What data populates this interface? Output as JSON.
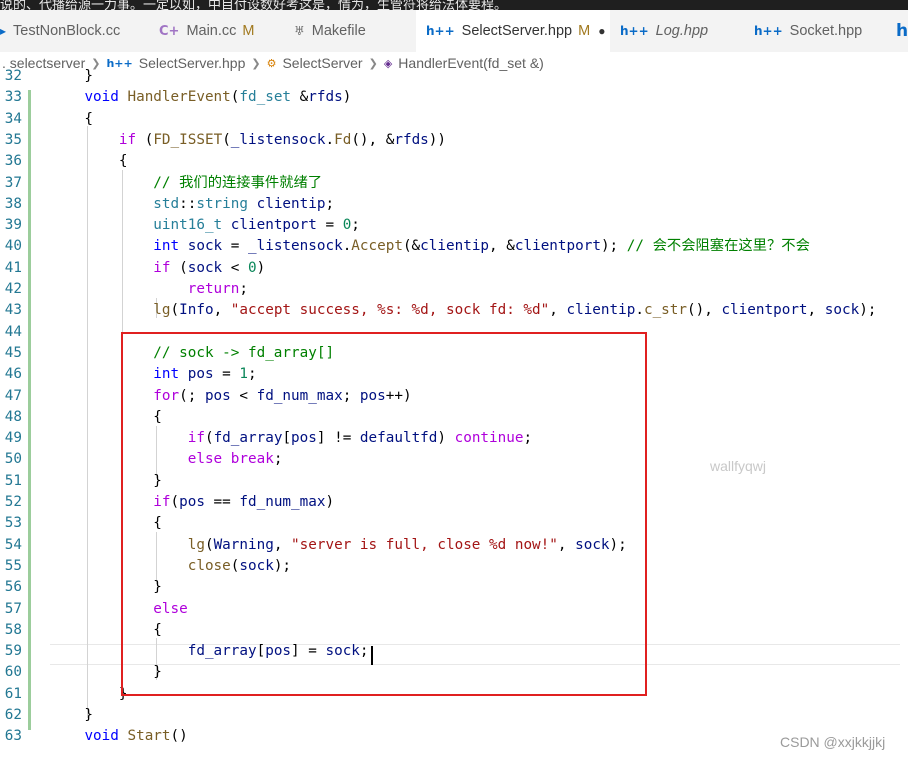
{
  "banner": {
    "text": "说的、代播给源一力事。一定以如，中目付设数好考这是，情为，生管符将给法体要程。"
  },
  "tabs": [
    {
      "icon": "arrow-icon",
      "label": "TestNonBlock.cc",
      "modified": ""
    },
    {
      "icon": "cpp-file-icon",
      "icon_text": "C++",
      "label": "Main.cc",
      "modified": "M"
    },
    {
      "icon": "makefile-icon",
      "label": "Makefile",
      "modified": ""
    },
    {
      "icon": "hpp-file-icon",
      "icon_text": "h++",
      "label": "SelectServer.hpp",
      "modified": "M",
      "active": true,
      "unsaved": "●"
    },
    {
      "icon": "hpp-file-icon",
      "icon_text": "h++",
      "label": "Log.hpp",
      "modified": ""
    },
    {
      "icon": "hpp-file-icon",
      "icon_text": "h++",
      "label": "Socket.hpp",
      "modified": ""
    },
    {
      "icon": "hpp-file-icon",
      "icon_text": "h",
      "label": "",
      "modified": ""
    }
  ],
  "breadcrumb": {
    "folder": ". selectserver",
    "file": "SelectServer.hpp",
    "class": "SelectServer",
    "method": "HandlerEvent(fd_set &)"
  },
  "editor": {
    "line_numbers": [
      "32",
      "33",
      "34",
      "35",
      "36",
      "37",
      "38",
      "39",
      "40",
      "41",
      "42",
      "43",
      "44",
      "45",
      "46",
      "47",
      "48",
      "49",
      "50",
      "51",
      "52",
      "53",
      "54",
      "55",
      "56",
      "57",
      "58",
      "59",
      "60",
      "61",
      "62",
      "63"
    ],
    "lines": [
      "    }",
      "    void HandlerEvent(fd_set &rfds)",
      "    {",
      "        if (FD_ISSET(_listensock.Fd(), &rfds))",
      "        {",
      "            // 我们的连接事件就绪了",
      "            std::string clientip;",
      "            uint16_t clientport = 0;",
      "            int sock = _listensock.Accept(&clientip, &clientport); // 会不会阻塞在这里？不会",
      "            if (sock < 0)",
      "                return;",
      "            lg(Info, \"accept success, %s: %d, sock fd: %d\", clientip.c_str(), clientport, sock);",
      "",
      "            // sock -> fd_array[]",
      "            int pos = 1;",
      "            for(; pos < fd_num_max; pos++)",
      "            {",
      "                if(fd_array[pos] != defaultfd) continue;",
      "                else break;",
      "            }",
      "            if(pos == fd_num_max)",
      "            {",
      "                lg(Warning, \"server is full, close %d now!\", sock);",
      "                close(sock);",
      "            }",
      "            else",
      "            {",
      "                fd_array[pos] = sock;",
      "            }",
      "        }",
      "    }",
      "    void Start()"
    ],
    "current_line": "59"
  },
  "watermarks": {
    "center": "wallfyqwj",
    "corner": "CSDN @xxjkkjjkj"
  },
  "colors": {
    "keyword": "#0000ff",
    "type": "#267f99",
    "function": "#795e26",
    "string": "#a31515",
    "comment": "#008000",
    "number": "#098658",
    "control": "#af00db",
    "highlight_box": "#e02020"
  }
}
